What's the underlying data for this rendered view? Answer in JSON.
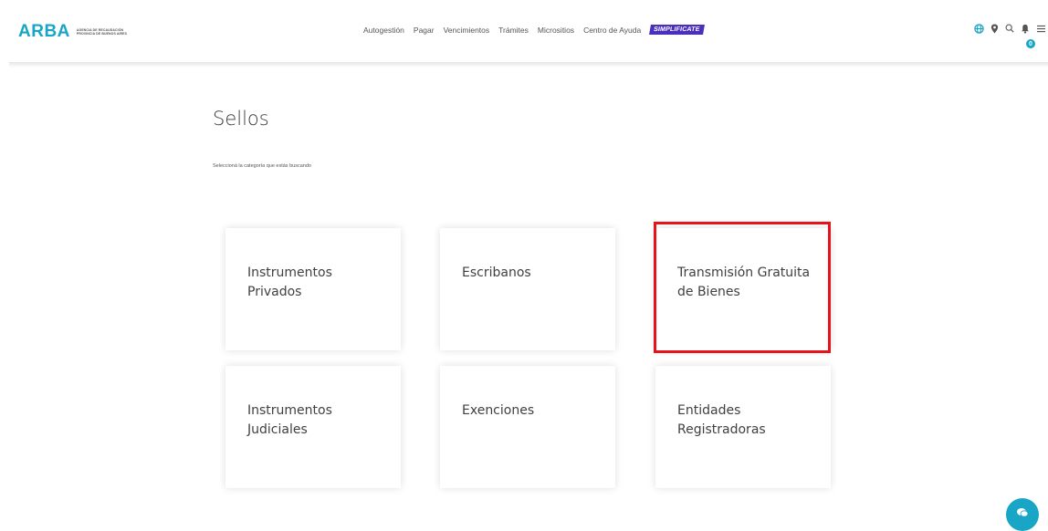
{
  "header": {
    "logo": {
      "word": "ARBA",
      "line1": "AGENCIA DE RECAUDACIÓN",
      "line2": "PROVINCIA DE BUENOS AIRES"
    },
    "nav": [
      {
        "label": "Autogestión"
      },
      {
        "label": "Pagar"
      },
      {
        "label": "Vencimientos"
      },
      {
        "label": "Trámites"
      },
      {
        "label": "Micrositios"
      },
      {
        "label": "Centro de Ayuda"
      }
    ],
    "nav_badge": "SIMPLIFICATE",
    "icons": [
      "globe-icon",
      "location-pin-icon",
      "search-icon",
      "bell-icon",
      "menu-icon"
    ],
    "notification_count": "0"
  },
  "page": {
    "title": "Sellos",
    "subtitle": "Seleccioná la categoría que estás buscando"
  },
  "cards": [
    {
      "label": "Instrumentos Privados"
    },
    {
      "label": "Escribanos"
    },
    {
      "label": "Transmisión Gratuita de Bienes",
      "highlighted": true
    },
    {
      "label": "Instrumentos Judiciales"
    },
    {
      "label": "Exenciones"
    },
    {
      "label": "Entidades Registradoras"
    }
  ],
  "colors": {
    "brand": "#19a5c6",
    "badge": "#4a2fbf",
    "highlight_border": "#e8121b"
  },
  "chat_icon": "chat-bubble-icon"
}
